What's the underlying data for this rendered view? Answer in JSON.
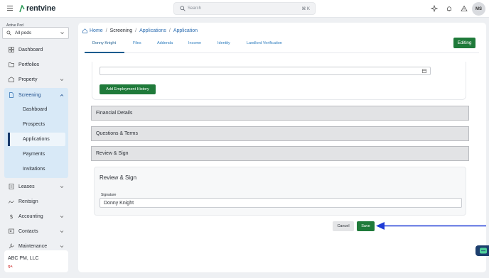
{
  "header": {
    "brand": "rentvine",
    "search_placeholder": "Search",
    "search_shortcut": "⌘ K",
    "avatar_initials": "MS"
  },
  "sidebar": {
    "pod_label": "Active Pod",
    "pod_value": "All pods",
    "items": {
      "dashboard": "Dashboard",
      "portfolios": "Portfolios",
      "property": "Property",
      "screening": "Screening",
      "leases": "Leases",
      "rentsign": "Rentsign",
      "accounting": "Accounting",
      "contacts": "Contacts",
      "maintenance": "Maintenance"
    },
    "screening_sub": {
      "dashboard": "Dashboard",
      "prospects": "Prospects",
      "applications": "Applications",
      "payments": "Payments",
      "invitations": "Invitations"
    },
    "org": {
      "name": "ABC PM, LLC",
      "tag": "QA"
    }
  },
  "breadcrumb": {
    "home": "Home",
    "screening": "Screening",
    "applications": "Applications",
    "current": "Application"
  },
  "tabs": {
    "applicant": "Donny Knight",
    "files": "Files",
    "addenda": "Addenda",
    "income": "Income",
    "identity": "Identity",
    "landlord": "Landlord Verification"
  },
  "editing_label": "Editing",
  "employment": {
    "add_button": "Add Employment History"
  },
  "sections": {
    "financial": "Financial Details",
    "questions": "Questions & Terms",
    "review": "Review & Sign"
  },
  "review": {
    "title": "Review & Sign",
    "signature_label": "Signature",
    "signature_value": "Donny Knight"
  },
  "actions": {
    "cancel": "Cancel",
    "save": "Save"
  },
  "colors": {
    "accent_green": "#1f7a3a",
    "link_blue": "#2b6cb0",
    "arrow_blue": "#1f3bd6",
    "screening_bg": "#d8e9f7"
  }
}
